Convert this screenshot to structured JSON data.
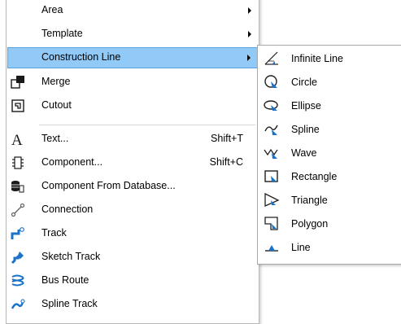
{
  "main_menu": {
    "items": [
      {
        "label": "Area",
        "has_submenu": true
      },
      {
        "label": "Template",
        "has_submenu": true
      },
      {
        "label": "Construction Line",
        "has_submenu": true,
        "highlighted": true
      },
      {
        "label": "Merge",
        "icon": "merge-icon"
      },
      {
        "label": "Cutout",
        "icon": "cutout-icon"
      },
      {
        "label": "Text...",
        "shortcut": "Shift+T",
        "icon": "text-icon"
      },
      {
        "label": "Component...",
        "shortcut": "Shift+C",
        "icon": "component-icon"
      },
      {
        "label": "Component From Database...",
        "icon": "database-component-icon"
      },
      {
        "label": "Connection",
        "icon": "connection-icon"
      },
      {
        "label": "Track",
        "icon": "track-icon"
      },
      {
        "label": "Sketch Track",
        "icon": "sketch-track-icon"
      },
      {
        "label": "Bus Route",
        "icon": "bus-route-icon"
      },
      {
        "label": "Spline Track",
        "icon": "spline-track-icon"
      }
    ]
  },
  "sub_menu": {
    "items": [
      {
        "label": "Infinite Line",
        "icon": "infinite-line-icon"
      },
      {
        "label": "Circle",
        "icon": "circle-icon"
      },
      {
        "label": "Ellipse",
        "icon": "ellipse-icon"
      },
      {
        "label": "Spline",
        "icon": "spline-icon"
      },
      {
        "label": "Wave",
        "icon": "wave-icon"
      },
      {
        "label": "Rectangle",
        "icon": "rectangle-icon"
      },
      {
        "label": "Triangle",
        "icon": "triangle-icon"
      },
      {
        "label": "Polygon",
        "icon": "polygon-icon"
      },
      {
        "label": "Line",
        "icon": "line-icon"
      }
    ]
  },
  "colors": {
    "highlight_bg": "#91c9f7",
    "highlight_border": "#5ba3e0",
    "icon_blue": "#1a73c8",
    "icon_dark": "#202020"
  }
}
